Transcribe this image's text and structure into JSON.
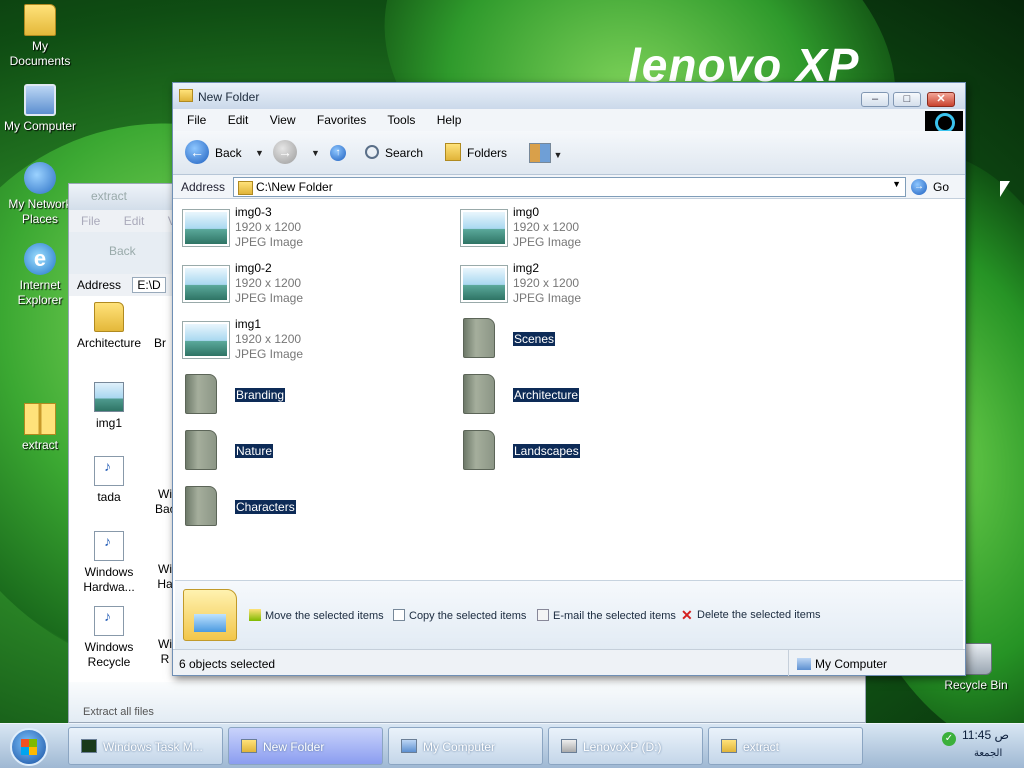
{
  "brand": "lenovo XP",
  "desktop_icons": [
    {
      "label": "My Documents",
      "icon": "my-documents-icon"
    },
    {
      "label": "My Computer",
      "icon": "my-computer-icon"
    },
    {
      "label": "My Network Places",
      "icon": "network-icon"
    },
    {
      "label": "Internet Explorer",
      "icon": "internet-explorer-icon"
    },
    {
      "label": "extract",
      "icon": "zip-folder-icon"
    },
    {
      "label": "Recycle Bin",
      "icon": "recycle-bin-icon"
    }
  ],
  "bg_window": {
    "title": "extract",
    "menu": [
      "File",
      "Edit",
      "Vi"
    ],
    "back": "Back",
    "address_label": "Address",
    "address_value": "E:\\D",
    "items": [
      "Architecture",
      "Br",
      "img1",
      "tada",
      "Windows Hardwa...",
      "Windows Recycle",
      "Wi Bac",
      "Wi Ha",
      "Wi R"
    ],
    "footer": "Extract all files"
  },
  "window": {
    "title": "New Folder",
    "menu": [
      "File",
      "Edit",
      "View",
      "Favorites",
      "Tools",
      "Help"
    ],
    "toolbar": {
      "back": "Back",
      "search": "Search",
      "folders": "Folders"
    },
    "address_label": "Address",
    "address_value": "C:\\New Folder",
    "go": "Go",
    "files": [
      {
        "name": "img0-3",
        "dims": "1920 x 1200",
        "type": "JPEG Image"
      },
      {
        "name": "img0",
        "dims": "1920 x 1200",
        "type": "JPEG Image"
      },
      {
        "name": "img0-2",
        "dims": "1920 x 1200",
        "type": "JPEG Image"
      },
      {
        "name": "img2",
        "dims": "1920 x 1200",
        "type": "JPEG Image"
      },
      {
        "name": "img1",
        "dims": "1920 x 1200",
        "type": "JPEG Image"
      }
    ],
    "folders": [
      "Scenes",
      "Branding",
      "Architecture",
      "Nature",
      "Landscapes",
      "Characters"
    ],
    "tasks": [
      "Move the selected items",
      "Copy the selected items",
      "E-mail the selected items",
      "Delete the selected items"
    ],
    "status_left": "6 objects selected",
    "status_right": "My Computer"
  },
  "taskbar": {
    "buttons": [
      "Windows Task M...",
      "New Folder",
      "My Computer",
      "LenovoXP (D:)",
      "extract"
    ],
    "clock": "11:45 ص",
    "day": "الجمعة"
  }
}
